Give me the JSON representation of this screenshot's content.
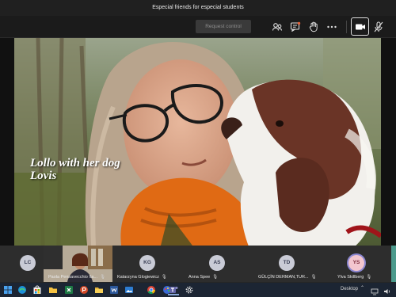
{
  "window": {
    "title": "Especial friends for especial students"
  },
  "toolbar": {
    "request_control_label": "Request control",
    "icons": [
      "participants-icon",
      "chat-icon",
      "raise-hand-icon",
      "more-icon",
      "camera-icon",
      "microphone-icon"
    ]
  },
  "stage": {
    "caption_line1": "Lollo with her dog",
    "caption_line2": "Lovis"
  },
  "participants": [
    {
      "initials": "LC",
      "name": ""
    },
    {
      "initials": "",
      "name": "Paola Pensavecchio Ita..."
    },
    {
      "initials": "KG",
      "name": "Katarzyna Glogiewicz"
    },
    {
      "initials": "AS",
      "name": "Anna Spee"
    },
    {
      "initials": "TD",
      "name": "GÜLÇİN DERMAN,TUR..."
    },
    {
      "initials": "YS",
      "name": "Ylva Skillberg"
    }
  ],
  "taskbar": {
    "desktop_label": "Desktop",
    "apps": [
      "start-icon",
      "edge-icon",
      "store-icon",
      "explorer-icon",
      "excel-icon",
      "powerpoint-icon",
      "folder-icon",
      "word-icon",
      "photos-icon",
      "chrome-icon",
      "paint-icon",
      "teams-icon",
      "settings-icon"
    ]
  },
  "colors": {
    "accent": "#6264a7",
    "background": "#1f1f1f"
  }
}
